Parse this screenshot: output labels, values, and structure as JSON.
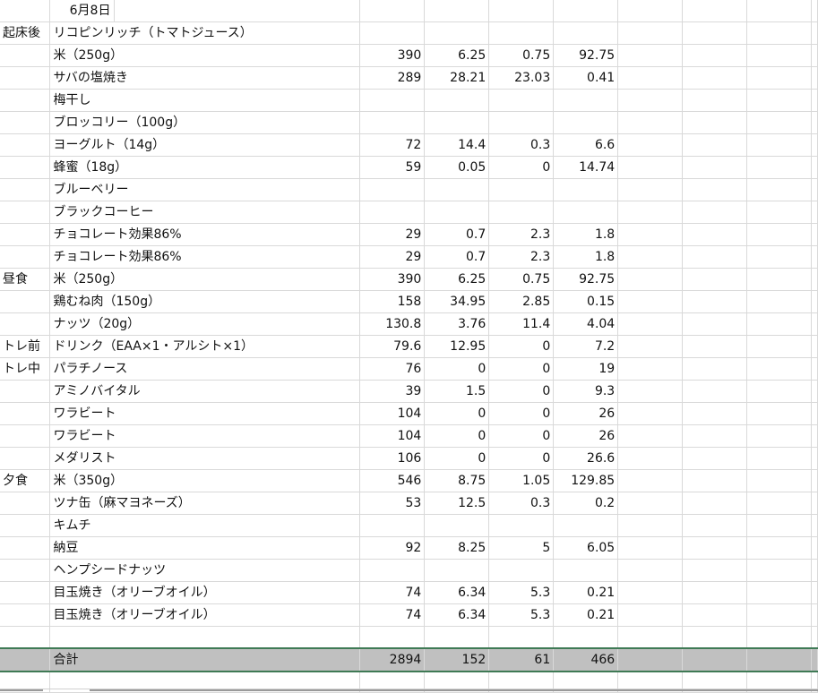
{
  "sheet": {
    "date": "6月8日",
    "rows": [
      {
        "meal": "起床後",
        "item": "リコピンリッチ（トマトジュース）",
        "kcal": "",
        "protein": "",
        "fat": "",
        "carb": ""
      },
      {
        "meal": "",
        "item": "米（250g）",
        "kcal": "390",
        "protein": "6.25",
        "fat": "0.75",
        "carb": "92.75"
      },
      {
        "meal": "",
        "item": "サバの塩焼き",
        "kcal": "289",
        "protein": "28.21",
        "fat": "23.03",
        "carb": "0.41"
      },
      {
        "meal": "",
        "item": "梅干し",
        "kcal": "",
        "protein": "",
        "fat": "",
        "carb": ""
      },
      {
        "meal": "",
        "item": "ブロッコリー（100g）",
        "kcal": "",
        "protein": "",
        "fat": "",
        "carb": ""
      },
      {
        "meal": "",
        "item": "ヨーグルト（14g）",
        "kcal": "72",
        "protein": "14.4",
        "fat": "0.3",
        "carb": "6.6"
      },
      {
        "meal": "",
        "item": "蜂蜜（18g）",
        "kcal": "59",
        "protein": "0.05",
        "fat": "0",
        "carb": "14.74"
      },
      {
        "meal": "",
        "item": "ブルーベリー",
        "kcal": "",
        "protein": "",
        "fat": "",
        "carb": ""
      },
      {
        "meal": "",
        "item": "ブラックコーヒー",
        "kcal": "",
        "protein": "",
        "fat": "",
        "carb": ""
      },
      {
        "meal": "",
        "item": "チョコレート効果86%",
        "kcal": "29",
        "protein": "0.7",
        "fat": "2.3",
        "carb": "1.8"
      },
      {
        "meal": "",
        "item": "チョコレート効果86%",
        "kcal": "29",
        "protein": "0.7",
        "fat": "2.3",
        "carb": "1.8"
      },
      {
        "meal": "昼食",
        "item": "米（250g）",
        "kcal": "390",
        "protein": "6.25",
        "fat": "0.75",
        "carb": "92.75"
      },
      {
        "meal": "",
        "item": "鶏むね肉（150g）",
        "kcal": "158",
        "protein": "34.95",
        "fat": "2.85",
        "carb": "0.15"
      },
      {
        "meal": "",
        "item": "ナッツ（20g）",
        "kcal": "130.8",
        "protein": "3.76",
        "fat": "11.4",
        "carb": "4.04"
      },
      {
        "meal": "トレ前",
        "item": "ドリンク（EAA×1・アルシト×1）",
        "kcal": "79.6",
        "protein": "12.95",
        "fat": "0",
        "carb": "7.2"
      },
      {
        "meal": "トレ中",
        "item": "パラチノース",
        "kcal": "76",
        "protein": "0",
        "fat": "0",
        "carb": "19"
      },
      {
        "meal": "",
        "item": "アミノバイタル",
        "kcal": "39",
        "protein": "1.5",
        "fat": "0",
        "carb": "9.3"
      },
      {
        "meal": "",
        "item": "ワラビート",
        "kcal": "104",
        "protein": "0",
        "fat": "0",
        "carb": "26"
      },
      {
        "meal": "",
        "item": "ワラビート",
        "kcal": "104",
        "protein": "0",
        "fat": "0",
        "carb": "26"
      },
      {
        "meal": "",
        "item": "メダリスト",
        "kcal": "106",
        "protein": "0",
        "fat": "0",
        "carb": "26.6"
      },
      {
        "meal": "夕食",
        "item": "米（350g）",
        "kcal": "546",
        "protein": "8.75",
        "fat": "1.05",
        "carb": "129.85"
      },
      {
        "meal": "",
        "item": "ツナ缶（麻マヨネーズ）",
        "kcal": "53",
        "protein": "12.5",
        "fat": "0.3",
        "carb": "0.2"
      },
      {
        "meal": "",
        "item": "キムチ",
        "kcal": "",
        "protein": "",
        "fat": "",
        "carb": ""
      },
      {
        "meal": "",
        "item": "納豆",
        "kcal": "92",
        "protein": "8.25",
        "fat": "5",
        "carb": "6.05"
      },
      {
        "meal": "",
        "item": "ヘンプシードナッツ",
        "kcal": "",
        "protein": "",
        "fat": "",
        "carb": ""
      },
      {
        "meal": "",
        "item": "目玉焼き（オリーブオイル）",
        "kcal": "74",
        "protein": "6.34",
        "fat": "5.3",
        "carb": "0.21"
      },
      {
        "meal": "",
        "item": "目玉焼き（オリーブオイル）",
        "kcal": "74",
        "protein": "6.34",
        "fat": "5.3",
        "carb": "0.21"
      }
    ],
    "total": {
      "label": "合計",
      "kcal": "2894",
      "protein": "152",
      "fat": "61",
      "carb": "466"
    }
  }
}
